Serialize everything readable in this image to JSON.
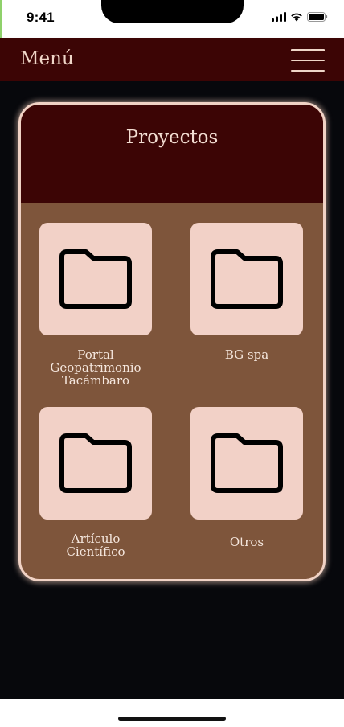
{
  "status_bar": {
    "time": "9:41",
    "icons": [
      "cellular-signal-icon",
      "wifi-icon",
      "battery-icon"
    ]
  },
  "header": {
    "menu_label": "Menú",
    "menu_icon": "hamburger-menu-icon"
  },
  "projects": {
    "title": "Proyectos",
    "folders": [
      {
        "label": "Portal\nGeopatrimonio\nTacámbaro",
        "icon": "folder-icon"
      },
      {
        "label": "BG spa",
        "icon": "folder-icon"
      },
      {
        "label": "Artículo\nCientífico",
        "icon": "folder-icon"
      },
      {
        "label": "Otros",
        "icon": "folder-icon"
      }
    ]
  },
  "colors": {
    "header_bg": "#3c0505",
    "card_bg": "#7e553b",
    "tile_bg": "#f2d1c7",
    "page_bg": "#07080c",
    "accent_text": "#efd6c8"
  }
}
